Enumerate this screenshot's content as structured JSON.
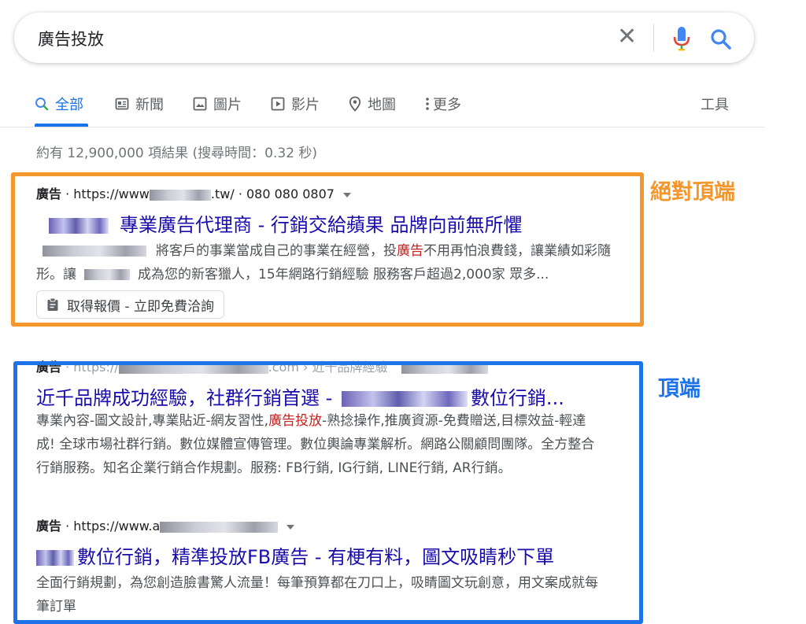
{
  "search": {
    "query": "廣告投放"
  },
  "tabs": [
    {
      "label": "全部",
      "icon": "search-icon",
      "active": true
    },
    {
      "label": "新聞",
      "icon": "news-icon"
    },
    {
      "label": "圖片",
      "icon": "image-icon"
    },
    {
      "label": "影片",
      "icon": "video-icon"
    },
    {
      "label": "地圖",
      "icon": "map-pin-icon"
    },
    {
      "label": "更多",
      "icon": "more-vert-icon"
    }
  ],
  "tools_label": "工具",
  "stats": "約有 12,900,000 項結果 (搜尋時間：0.32 秒)",
  "results": [
    {
      "ad_label": "廣告",
      "url_prefix": "https://www",
      "url_suffix": ".tw/",
      "phone": "080 080 0807",
      "title": "專業廣告代理商 - 行銷交給蘋果 品牌向前無所懼",
      "snippet_line1_a": "將客戶的事業當成自己的事業在經營，投",
      "snippet_line1_hl": "廣告",
      "snippet_line1_b": "不用再怕浪費錢，讓業績如",
      "snippet_line1_c": "彩隨",
      "snippet_line2_a": "形。讓",
      "snippet_line2_b": "成為您的新客獵人，15年網路行銷經驗 服務客戶超過2,000家 眾多...",
      "sitelink": "取得報價 - 立即免費洽詢"
    },
    {
      "ad_label": "廣告",
      "url_prefix": "https://",
      "url_mid": ".com",
      "url_crumb": "近千品牌經驗",
      "title_a": "近千品牌成功經驗，社群行銷首選 -",
      "title_b": "數位行銷...",
      "snippet_line1_a": "專業內容-圖文設計,專業貼近-網友習性,",
      "snippet_line1_hl": "廣告投放",
      "snippet_line1_b": "-熟捻操作,推廣資源-免費贈送,目標效益-輕",
      "snippet_line1_c": "達",
      "snippet_line2": "成! 全球市場社群行銷。數位媒體宣傳管理。數位輿論專業解析。網路公關顧問團隊。全方",
      "snippet_line2_c": "整合",
      "snippet_line3": "行銷服務。知名企業行銷合作規劃。服務: FB行銷, IG行銷, LINE行銷, AR行銷。"
    },
    {
      "ad_label": "廣告",
      "url_prefix": "https://www.a",
      "title": "數位行銷，精準投放FB廣告 - 有梗有料，圖文吸睛秒下單",
      "snippet_line1": "全面行銷規劃，為您創造臉書驚人流量！每筆預算都在刀口上，吸睛圖文玩創意，用文案成",
      "snippet_line1_c": "就每",
      "snippet_line2": "筆訂單"
    }
  ],
  "annotations": {
    "orange_label": "絕對頂端",
    "blue_label": "頂端",
    "orange_color": "#f3962c",
    "blue_color": "#1e73e8"
  }
}
